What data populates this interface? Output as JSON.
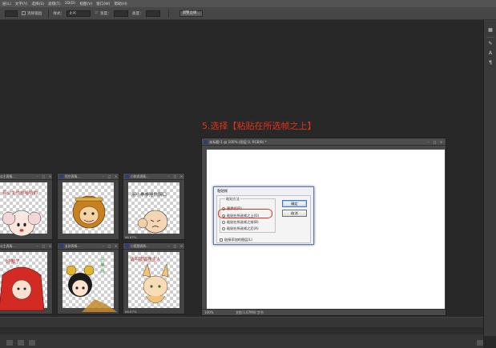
{
  "menu": [
    "层(L)",
    "文字(Y)",
    "选择(S)",
    "滤镜(T)",
    "3D(D)",
    "视图(V)",
    "窗口(W)",
    "帮助(H)"
  ],
  "options": {
    "edges_label": "消除锯齿",
    "style_label": "样式：",
    "style_value": "正常",
    "width_label": "宽度：",
    "height_label": "高度：",
    "refine_button": "调整边缘..."
  },
  "instruction": "5.选择【粘贴在所选帧之上】",
  "thumbnails": [
    {
      "title": "公主表情...",
      "zoom": "",
      "text": "有公主也挂哈哈的"
    },
    {
      "title": "悟空表情...",
      "zoom": "",
      "text": ""
    },
    {
      "title": "小和尚表情...",
      "zoom": "66.67%",
      "text": "用小拳拳捶你胸口"
    },
    {
      "title": "公主表情...",
      "zoom": "",
      "text": "好傲了"
    },
    {
      "title": "女孩表情...",
      "zoom": "",
      "text": "开 黑 吗"
    },
    {
      "title": "小狐狸表情...",
      "zoom": "66.67%",
      "text": "请叫我狐狸主人"
    }
  ],
  "document": {
    "title": "未标题-1 @ 100% (图层 0, RGB/8) *",
    "zoom": "100%",
    "doc_info": "文档:1.67M/0 字节"
  },
  "dialog": {
    "title": "粘贴帧",
    "group_title": "粘贴方法",
    "options": [
      {
        "label": "替换帧(R)",
        "selected": false
      },
      {
        "label": "粘贴在所选帧之上(O)",
        "selected": true
      },
      {
        "label": "粘贴在所选帧之前(B)",
        "selected": false
      },
      {
        "label": "粘贴在所选帧之后(A)",
        "selected": false
      }
    ],
    "checkbox_label": "链接添加的图层(L)",
    "ok_label": "确定",
    "cancel_label": "取消"
  },
  "colors": {
    "annotation": "#e2331a",
    "workspace": "#282828",
    "dialog_accent": "#3d7bd6"
  }
}
